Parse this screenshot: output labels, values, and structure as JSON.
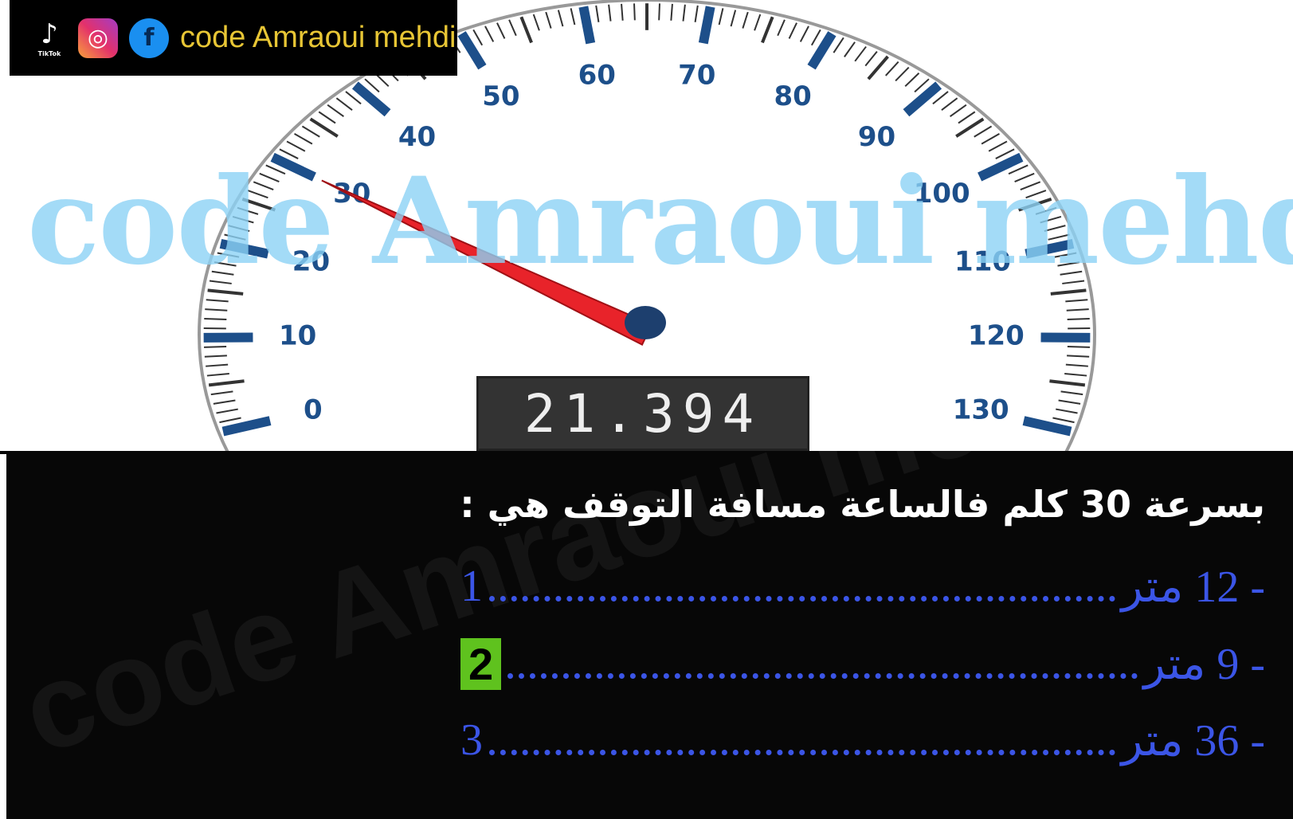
{
  "branding": {
    "tiktok_label": "TikTok",
    "text": "code Amraoui mehdi",
    "icons": [
      "tiktok-icon",
      "instagram-icon",
      "facebook-icon"
    ]
  },
  "watermark": "code Amraoui mehdi",
  "gauge": {
    "ticks": [
      "0",
      "10",
      "20",
      "30",
      "40",
      "50",
      "60",
      "70",
      "80",
      "90",
      "100",
      "110",
      "120",
      "130"
    ],
    "min": 0,
    "max": 130,
    "needle_value": 30,
    "readout": "21.394",
    "needle_color": "#e8232a",
    "tick_color": "#1d4f8a"
  },
  "question": "بسرعة 30 كلم فالساعة مسافة التوقف هي :",
  "options": [
    {
      "text": "- 12 متر",
      "number": "1",
      "selected": false
    },
    {
      "text": "- 9 متر",
      "number": "2",
      "selected": true
    },
    {
      "text": "- 36 متر",
      "number": "3",
      "selected": false
    }
  ],
  "colors": {
    "option": "#3b55e6",
    "selected": "#5fc21e"
  }
}
